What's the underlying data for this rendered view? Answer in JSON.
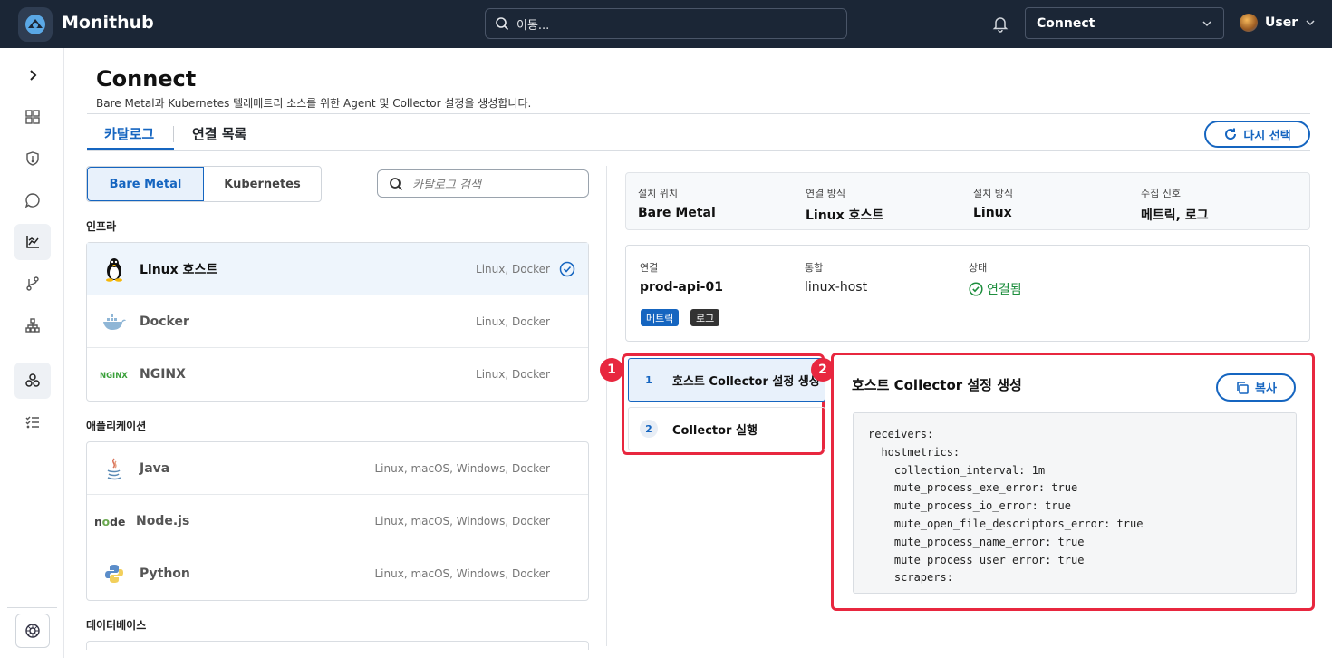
{
  "header": {
    "brand": "Monithub",
    "search_placeholder": "이동...",
    "connect_select": "Connect",
    "user_label": "User"
  },
  "sidebar": {
    "icons": [
      "chevron-right-icon",
      "dashboard-icon",
      "shield-icon",
      "chat-icon",
      "chart-icon",
      "git-branch-icon",
      "hierarchy-icon",
      "integrations-icon",
      "checklist-icon",
      "settings-icon"
    ]
  },
  "page": {
    "title": "Connect",
    "subtitle": "Bare Metal과 Kubernetes 텔레메트리 소스를 위한 Agent 및 Collector 설정을 생성합니다.",
    "tabs": [
      "카탈로그",
      "연결 목록"
    ],
    "reselect_label": "다시 선택"
  },
  "catalog": {
    "segments": [
      "Bare Metal",
      "Kubernetes"
    ],
    "search_placeholder": "카탈로그 검색",
    "sections": [
      {
        "title": "인프라",
        "items": [
          {
            "name": "Linux 호스트",
            "platforms": "Linux, Docker",
            "selected": true
          },
          {
            "name": "Docker",
            "platforms": "Linux, Docker"
          },
          {
            "name": "NGINX",
            "platforms": "Linux, Docker"
          }
        ]
      },
      {
        "title": "애플리케이션",
        "items": [
          {
            "name": "Java",
            "platforms": "Linux, macOS, Windows, Docker"
          },
          {
            "name": "Node.js",
            "platforms": "Linux, macOS, Windows, Docker"
          },
          {
            "name": "Python",
            "platforms": "Linux, macOS, Windows, Docker"
          }
        ]
      },
      {
        "title": "데이터베이스",
        "items": []
      }
    ]
  },
  "summary": [
    {
      "label": "설치 위치",
      "value": "Bare Metal"
    },
    {
      "label": "연결 방식",
      "value": "Linux 호스트"
    },
    {
      "label": "설치 방식",
      "value": "Linux"
    },
    {
      "label": "수집 신호",
      "value": "메트릭, 로그"
    }
  ],
  "connection": {
    "conn_label": "연결",
    "conn_value": "prod-api-01",
    "integ_label": "통합",
    "integ_value": "linux-host",
    "status_label": "상태",
    "status_value": "연결됨",
    "badges": [
      "메트릭",
      "로그"
    ]
  },
  "steps": [
    {
      "num": "1",
      "label": "호스트 Collector 설정 생성"
    },
    {
      "num": "2",
      "label": "Collector 실행"
    }
  ],
  "markers": [
    "1",
    "2"
  ],
  "config": {
    "title": "호스트 Collector 설정 생성",
    "copy_label": "복사",
    "lines": [
      "receivers:",
      "  hostmetrics:",
      "    collection_interval: 1m",
      "    mute_process_exe_error: true",
      "    mute_process_io_error: true",
      "    mute_open_file_descriptors_error: true",
      "    mute_process_name_error: true",
      "    mute_process_user_error: true",
      "    scrapers:"
    ]
  },
  "colors": {
    "accent": "#1565c0",
    "topbar": "#1b2636",
    "highlight": "#e8273f",
    "success": "#1e8e3e"
  }
}
